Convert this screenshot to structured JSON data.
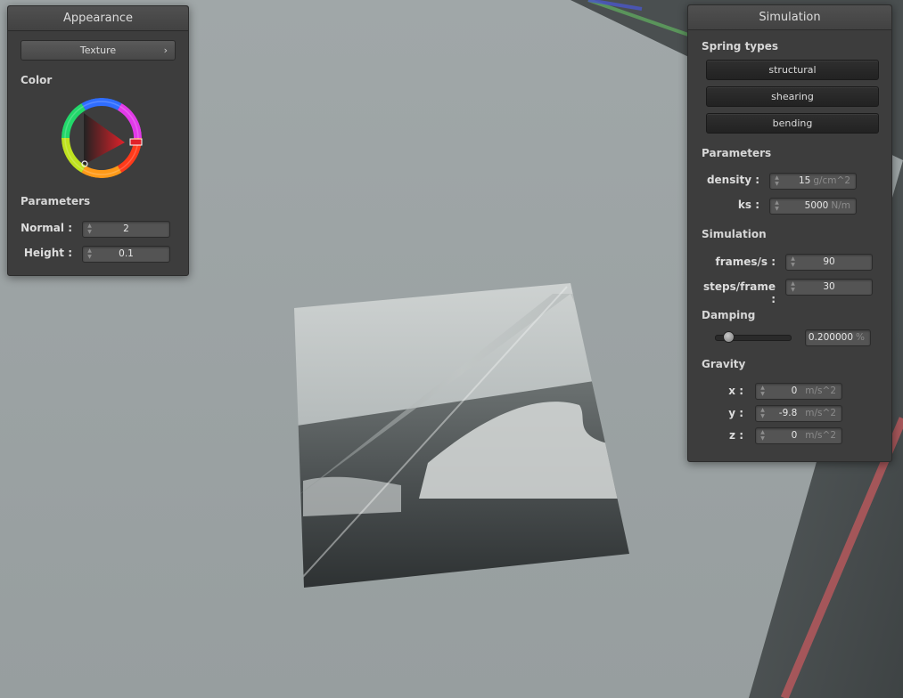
{
  "appearance": {
    "title": "Appearance",
    "texture_button": "Texture",
    "color_label": "Color",
    "color": {
      "hue": "#e0222a"
    },
    "parameters_label": "Parameters",
    "normal": {
      "label": "Normal :",
      "value": "2"
    },
    "height": {
      "label": "Height :",
      "value": "0.1"
    }
  },
  "simulation": {
    "title": "Simulation",
    "spring_types_label": "Spring types",
    "spring_buttons": [
      "structural",
      "shearing",
      "bending"
    ],
    "parameters_label": "Parameters",
    "density": {
      "label": "density :",
      "value": "15",
      "unit": "g/cm^2"
    },
    "ks": {
      "label": "ks :",
      "value": "5000",
      "unit": "N/m"
    },
    "simulation_label": "Simulation",
    "frames": {
      "label": "frames/s :",
      "value": "90"
    },
    "steps": {
      "label": "steps/frame :",
      "value": "30"
    },
    "damping_label": "Damping",
    "damping": {
      "value": "0.200000",
      "unit": "%",
      "slider_fraction": 0.17
    },
    "gravity_label": "Gravity",
    "gravity_x": {
      "label": "x :",
      "value": "0",
      "unit": "m/s^2"
    },
    "gravity_y": {
      "label": "y :",
      "value": "-9.8",
      "unit": "m/s^2"
    },
    "gravity_z": {
      "label": "z :",
      "value": "0",
      "unit": "m/s^2"
    }
  },
  "icons": {
    "spin": "spin-arrows-icon",
    "chevron": "chevron-right-icon"
  }
}
